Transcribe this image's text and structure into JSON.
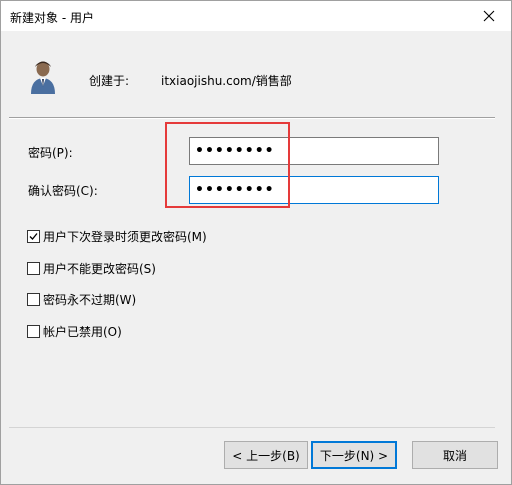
{
  "window": {
    "title": "新建对象 - 用户"
  },
  "header": {
    "created_in_label": "创建于:",
    "created_in_value": "itxiaojishu.com/销售部"
  },
  "form": {
    "password_label": "密码(P):",
    "password_value": "••••••••",
    "confirm_label": "确认密码(C):",
    "confirm_value": "••••••••"
  },
  "options": [
    {
      "label": "用户下次登录时须更改密码(M)",
      "checked": true
    },
    {
      "label": "用户不能更改密码(S)",
      "checked": false
    },
    {
      "label": "密码永不过期(W)",
      "checked": false
    },
    {
      "label": "帐户已禁用(O)",
      "checked": false
    }
  ],
  "buttons": {
    "back": "< 上一步(B)",
    "next": "下一步(N) >",
    "cancel": "取消"
  },
  "colors": {
    "accent": "#0078d7",
    "highlight": "#e53a3a",
    "dialog_bg": "#f0f0f0"
  }
}
